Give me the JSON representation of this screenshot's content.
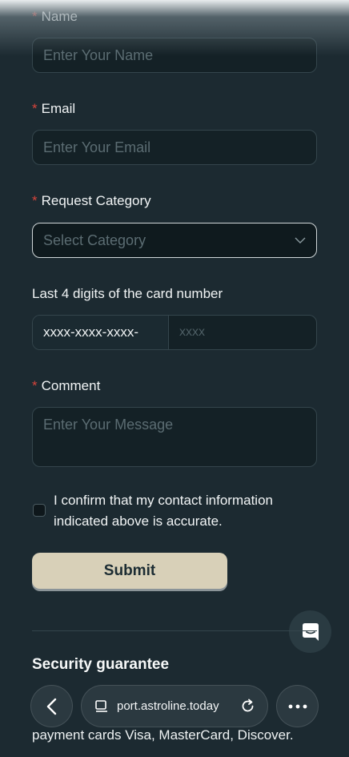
{
  "form": {
    "required_mark": "*",
    "name": {
      "label": "Name",
      "placeholder": "Enter Your Name"
    },
    "email": {
      "label": "Email",
      "placeholder": "Enter Your Email"
    },
    "category": {
      "label": "Request Category",
      "placeholder": "Select Category"
    },
    "card": {
      "label": "Last 4 digits of the card number",
      "prefix": "xxxx-xxxx-xxxx-",
      "placeholder": "xxxx"
    },
    "comment": {
      "label": "Comment",
      "placeholder": "Enter Your Message"
    },
    "confirm_text": "I confirm that my contact information indicated above is accurate.",
    "submit_label": "Submit"
  },
  "security": {
    "title": "Security guarantee",
    "text_tail": "payment cards Visa, MasterCard, Discover."
  },
  "browser": {
    "url": "port.astroline.today"
  },
  "colors": {
    "background": "#1c2a31",
    "required": "#d6443b",
    "submit_bg": "#d8d0b8"
  }
}
